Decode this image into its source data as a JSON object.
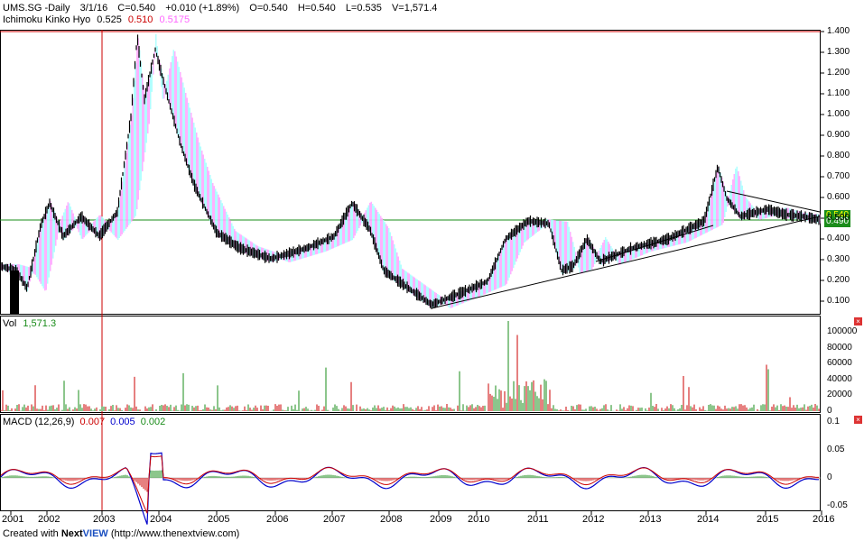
{
  "header": {
    "symbol": "UMS.SG -Daily",
    "date": "3/1/16",
    "close": "C=0.540",
    "change": "+0.010 (+1.89%)",
    "open": "O=0.540",
    "high": "H=0.540",
    "low": "L=0.535",
    "volume": "V=1,571.4"
  },
  "ichimoku": {
    "label": "Ichimoku Kinko Hyo",
    "v1": "0.525",
    "v2": "0.510",
    "v3": "0.5175",
    "color1": "#1a9a9a",
    "color2": "#ff66ff"
  },
  "price_axis": {
    "ticks": [
      "1.400",
      "1.300",
      "1.200",
      "1.100",
      "1.000",
      "0.900",
      "0.800",
      "0.700",
      "0.600",
      "0.500",
      "0.400",
      "0.300",
      "0.200",
      "0.100"
    ],
    "last_tag": "0.540",
    "ref_tag": "0.490",
    "tag_color": "#1a8c1a"
  },
  "volume_pane": {
    "label": "Vol",
    "value": "1,571.3",
    "ticks": [
      "100000",
      "80000",
      "60000",
      "40000",
      "20000",
      "0"
    ]
  },
  "macd_pane": {
    "label": "MACD (12,26,9)",
    "v1": "0.007",
    "v2": "0.005",
    "v3": "0.002",
    "ticks": [
      "0.1",
      "0.05",
      "0",
      "-0.05"
    ]
  },
  "time_axis": {
    "years": [
      "2001",
      "2002",
      "2003",
      "2004",
      "2005",
      "2006",
      "2007",
      "2008",
      "2009",
      "2010",
      "2011",
      "2012",
      "2013",
      "2014",
      "2015",
      "2016"
    ]
  },
  "footer": {
    "created": "Created with",
    "brand_a": "Next",
    "brand_b": "VIEW",
    "url": "(http://www.thenextview.com)"
  }
}
